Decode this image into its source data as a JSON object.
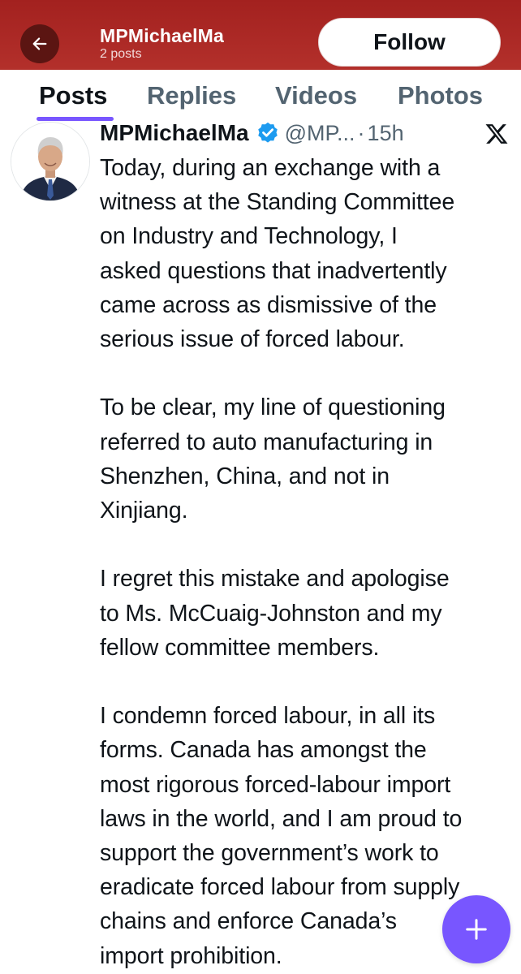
{
  "header": {
    "title": "MPMichaelMa",
    "post_count": "2 posts",
    "follow_label": "Follow",
    "background": "#a3211f"
  },
  "tabs": [
    {
      "label": "Posts",
      "active": true
    },
    {
      "label": "Replies",
      "active": false
    },
    {
      "label": "Videos",
      "active": false
    },
    {
      "label": "Photos",
      "active": false
    }
  ],
  "tweet": {
    "name": "MPMichaelMa",
    "verified_icon": "verified-badge-icon",
    "handle": "@MP...",
    "separator": "·",
    "time": "15h",
    "paragraphs": [
      [
        "Today, during an exchange with a",
        "witness at the Standing Committee",
        "on Industry and Technology, I",
        "asked questions that inadvertently",
        "came across as dismissive of the",
        "serious issue of forced labour."
      ],
      [
        "To be clear, my line of questioning",
        "referred to auto manufacturing in",
        "Shenzhen, China, and not in",
        "Xinjiang."
      ],
      [
        "I regret this mistake and apologise",
        "to Ms. McCuaig-Johnston and my",
        "fellow committee members."
      ],
      [
        "I condemn forced labour, in all its",
        "forms. Canada has amongst the",
        "most rigorous forced-labour import",
        "laws in the world, and I am proud to",
        "support the government’s work to",
        "eradicate forced labour from supply",
        "chains and enforce Canada’s",
        "import prohibition."
      ]
    ]
  },
  "colors": {
    "accent": "#7856ff",
    "verified": "#1d9bf0",
    "secondary_text": "#536471"
  },
  "icons": {
    "back": "back-arrow-icon",
    "platform": "x-logo-icon",
    "compose": "plus-icon"
  }
}
